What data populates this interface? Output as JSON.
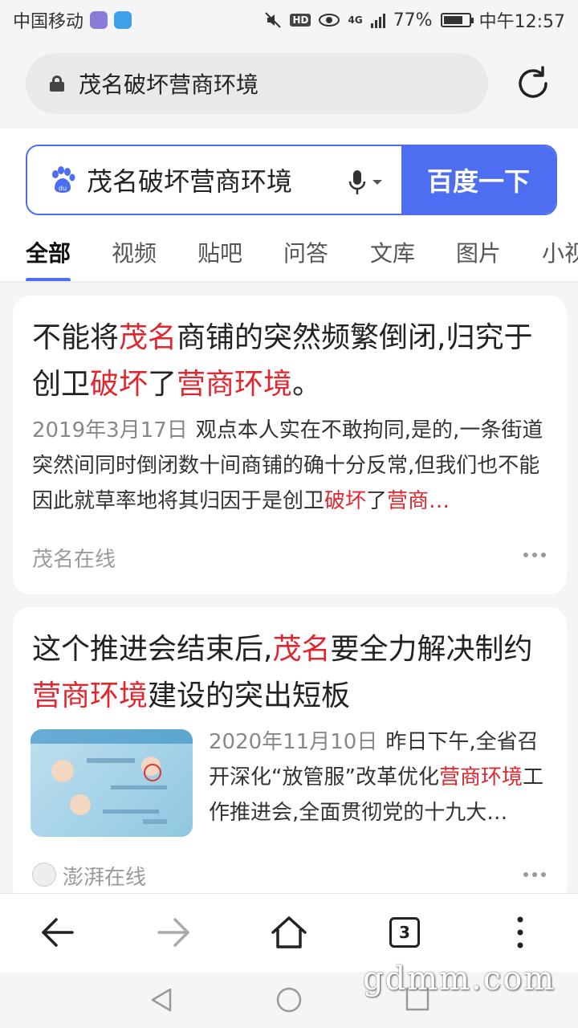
{
  "status_bar": {
    "carrier": "中国移动",
    "hd_label": "HD",
    "network": "4G",
    "battery": "77%",
    "battery_level": 0.77,
    "time": "中午12:57"
  },
  "browser": {
    "url_text": "茂名破坏营商环境"
  },
  "search": {
    "query": "茂名破坏营商环境",
    "button_label": "百度一下",
    "accent_color": "#4e6ef2"
  },
  "tabs": [
    "全部",
    "视频",
    "贴吧",
    "问答",
    "文库",
    "图片",
    "小视"
  ],
  "results": [
    {
      "title_parts": [
        {
          "t": "不能将",
          "hl": false
        },
        {
          "t": "茂名",
          "hl": true
        },
        {
          "t": "商铺的突然频繁倒闭,归究于创卫",
          "hl": false
        },
        {
          "t": "破坏",
          "hl": true
        },
        {
          "t": "了",
          "hl": false
        },
        {
          "t": "营商环境",
          "hl": true
        },
        {
          "t": "。",
          "hl": false
        }
      ],
      "date": "2019年3月17日",
      "snippet_parts": [
        {
          "t": "观点本人实在不敢拘同,是的,一条街道突然间同时倒闭数十间商铺的确十分反常,但我们也不能因此就草率地将其归因于是创卫",
          "hl": false
        },
        {
          "t": "破坏",
          "hl": true
        },
        {
          "t": "了",
          "hl": false
        },
        {
          "t": "营商…",
          "hl": true
        }
      ],
      "source": "茂名在线"
    },
    {
      "title_parts": [
        {
          "t": "这个推进会结束后,",
          "hl": false
        },
        {
          "t": "茂名",
          "hl": true
        },
        {
          "t": "要全力解决制约",
          "hl": false
        },
        {
          "t": "营商环境",
          "hl": true
        },
        {
          "t": "建设的突出短板",
          "hl": false
        }
      ],
      "date": "2020年11月10日",
      "snippet_parts": [
        {
          "t": "昨日下午,全省召开深化“放管服”改革优化",
          "hl": false
        },
        {
          "t": "营商环境",
          "hl": true
        },
        {
          "t": "工作推进会,全面贯彻党的十九大…",
          "hl": false
        }
      ],
      "source": "澎湃在线"
    }
  ],
  "bottom_nav": {
    "tab_count": "3"
  },
  "watermark": "gdmm.com",
  "colors": {
    "highlight": "#e0262e",
    "accent": "#4e6ef2"
  }
}
